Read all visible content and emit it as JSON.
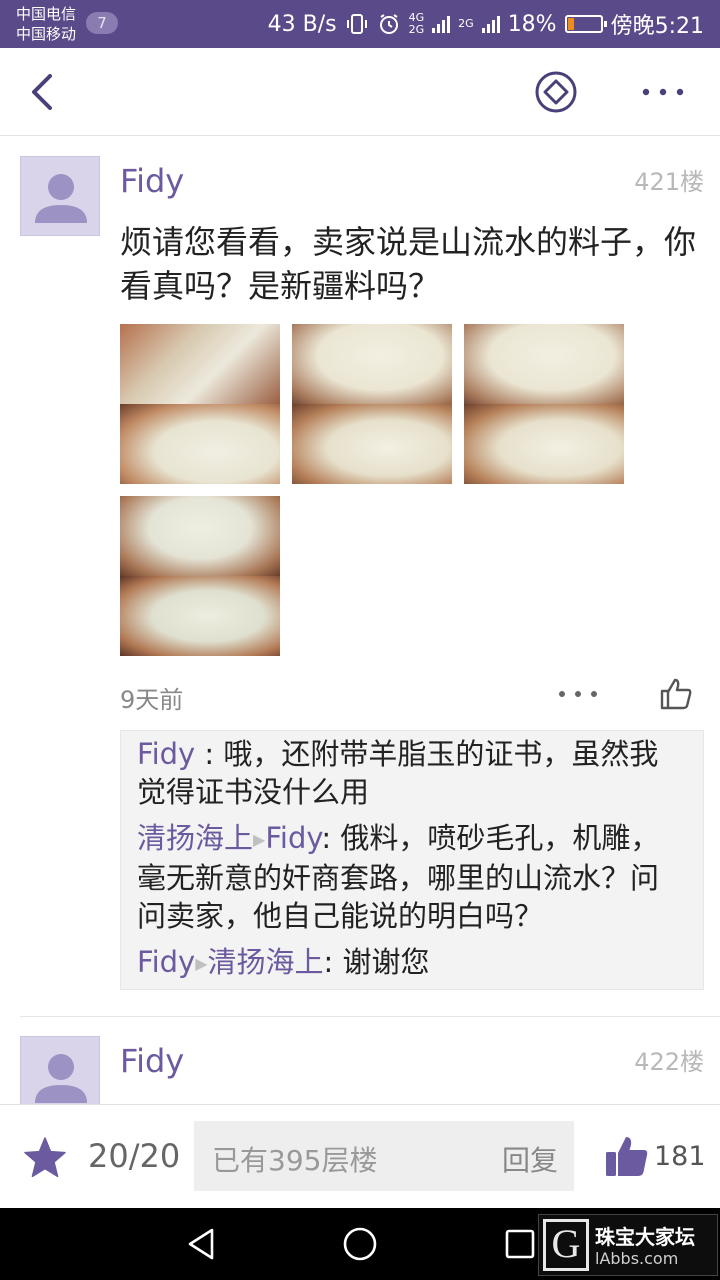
{
  "status_bar": {
    "carrier_1": "中国电信",
    "carrier_2": "中国移动",
    "notification_count": "7",
    "network_speed": "43 B/s",
    "net_type_1": "4G",
    "net_type_2": "2G",
    "net_type_3": "2G",
    "battery_percent": "18%",
    "battery_level": 0.18,
    "time": "傍晚5:21"
  },
  "nav": {
    "back_icon": "chevron-left-icon",
    "diamond_icon": "diamond-icon",
    "more_icon": "more-icon"
  },
  "posts": [
    {
      "username": "Fidy",
      "floor": "421楼",
      "content": "烦请您看看，卖家说是山流水的料子，你看真吗？是新疆料吗？",
      "time": "9天前",
      "comments": [
        {
          "from": "Fidy",
          "sep": " : ",
          "to": "",
          "text": "哦，还附带羊脂玉的证书，虽然我觉得证书没什么用"
        },
        {
          "from": "清扬海上",
          "sep": ": ",
          "to": "Fidy",
          "text": "俄料，喷砂毛孔，机雕，毫无新意的奸商套路，哪里的山流水？问问卖家，他自己能说的明白吗？"
        },
        {
          "from": "Fidy",
          "sep": ": ",
          "to": "清扬海上",
          "text": "谢谢您"
        }
      ]
    },
    {
      "username": "Fidy",
      "floor": "422楼"
    }
  ],
  "toolbar": {
    "page_count": "20/20",
    "reply_placeholder": "已有395层楼",
    "reply_label": "回复",
    "like_count": "181"
  },
  "watermark": {
    "letter": "G",
    "title": "珠宝大家坛",
    "site": "lAbbs.com"
  },
  "colors": {
    "accent": "#6b5aa0",
    "status_bar": "#5b4a8a",
    "battery": "#f08a1a"
  }
}
